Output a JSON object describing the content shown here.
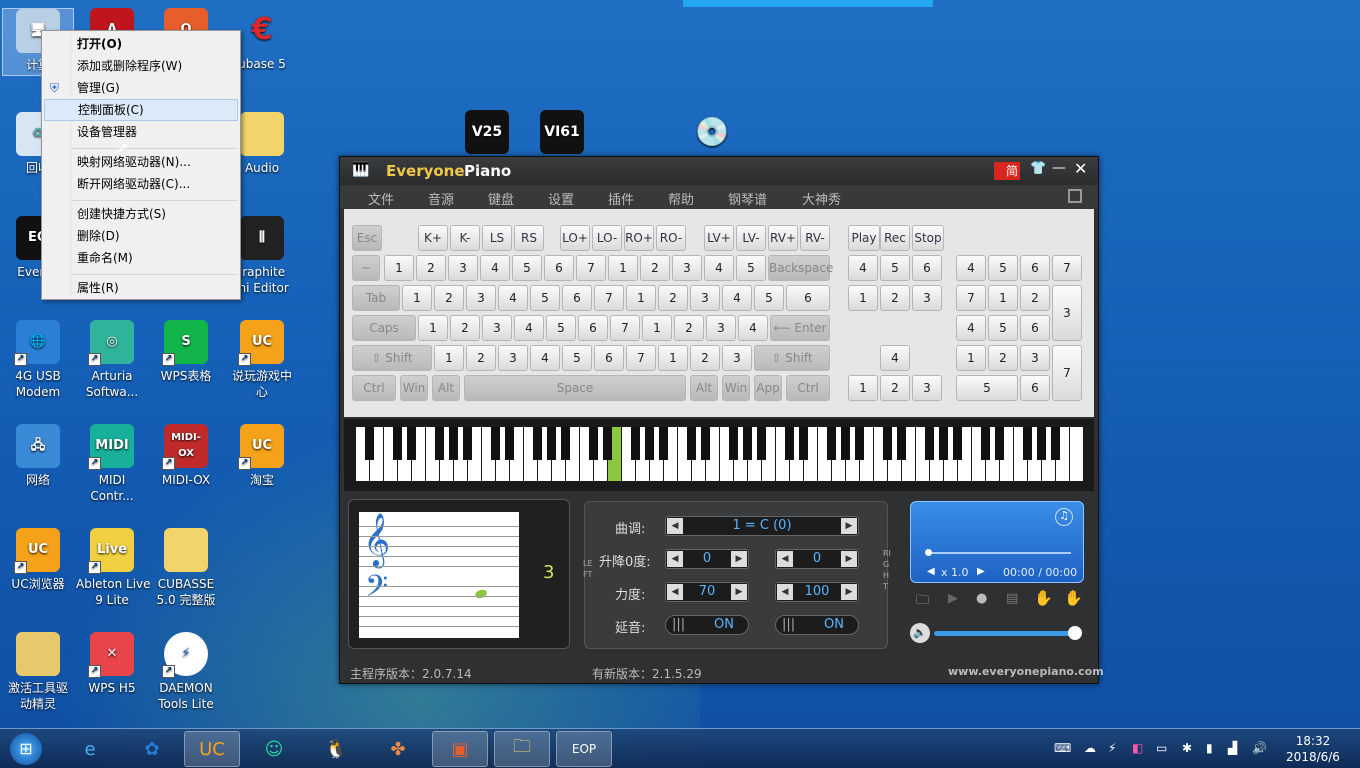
{
  "desktop_icons": [
    {
      "name": "computer",
      "label": "计算",
      "icon": "computer-icon"
    },
    {
      "name": "acrobat",
      "label": "",
      "icon": "acrobat-icon"
    },
    {
      "name": "office",
      "label": "",
      "icon": "office-icon"
    },
    {
      "name": "cubase5",
      "label": "ubase 5",
      "icon": "cubase-icon"
    },
    {
      "name": "recycle",
      "label": "回收",
      "icon": "recycle-bin-icon"
    },
    {
      "name": "audio",
      "label": "Audio",
      "icon": "folder-icon"
    },
    {
      "name": "everyone",
      "label": "Everyo",
      "icon": "everyone-piano-icon"
    },
    {
      "name": "graphite",
      "label": "iraphite\nini Editor",
      "icon": "mixer-icon"
    },
    {
      "name": "4gusb",
      "label": "4G USB\nModem",
      "icon": "globe-icon"
    },
    {
      "name": "arturia",
      "label": "Arturia\nSoftwa...",
      "icon": "arturia-icon"
    },
    {
      "name": "wps",
      "label": "WPS表格",
      "icon": "wps-sheet-icon"
    },
    {
      "name": "shuowan",
      "label": "说玩游戏中\n心",
      "icon": "uc-icon"
    },
    {
      "name": "network",
      "label": "网络",
      "icon": "network-icon"
    },
    {
      "name": "midi",
      "label": "MIDI\nContr...",
      "icon": "midi-icon"
    },
    {
      "name": "midiox",
      "label": "MIDI-OX",
      "icon": "midiox-icon"
    },
    {
      "name": "taobao",
      "label": "淘宝",
      "icon": "uc-icon"
    },
    {
      "name": "uc",
      "label": "UC浏览器",
      "icon": "uc-icon"
    },
    {
      "name": "ableton",
      "label": "Ableton Live\n9 Lite",
      "icon": "ableton-icon"
    },
    {
      "name": "cubasefolder",
      "label": "CUBASSE\n5.0 完整版",
      "icon": "folder-icon"
    },
    {
      "name": "jihuo",
      "label": "激活工具驱\n动精灵",
      "icon": "folder-red-icon"
    },
    {
      "name": "wpsh5",
      "label": "WPS H5",
      "icon": "wps-h5-icon"
    },
    {
      "name": "daemon",
      "label": "DAEMON\nTools Lite",
      "icon": "daemon-icon"
    },
    {
      "name": "v25",
      "label": "",
      "icon": "v25-icon"
    },
    {
      "name": "vi61",
      "label": "",
      "icon": "vi61-icon"
    },
    {
      "name": "installer",
      "label": "",
      "icon": "installer-icon"
    }
  ],
  "context_menu": [
    {
      "label": "打开(O)",
      "bold": true
    },
    {
      "label": "添加或删除程序(W)"
    },
    {
      "label": "管理(G)"
    },
    {
      "label": "控制面板(C)"
    },
    {
      "label": "设备管理器"
    },
    {
      "label": "映射网络驱动器(N)..."
    },
    {
      "label": "断开网络驱动器(C)..."
    },
    {
      "label": "创建快捷方式(S)"
    },
    {
      "label": "删除(D)"
    },
    {
      "label": "重命名(M)"
    },
    {
      "label": "属性(R)"
    }
  ],
  "app": {
    "title": "Everyone",
    "title2": "Piano",
    "lang": "简",
    "menus": [
      "文件",
      "音源",
      "键盘",
      "设置",
      "插件",
      "帮助",
      "钢琴谱",
      "大神秀"
    ],
    "row0": [
      "Esc",
      "K+",
      "K-",
      "LS",
      "RS",
      "LO+",
      "LO-",
      "RO+",
      "RO-",
      "LV+",
      "LV-",
      "RV+",
      "RV-",
      "Play",
      "Rec",
      "Stop"
    ],
    "backspace": "Backspace",
    "tab": "Tab",
    "caps": "Caps",
    "enter": "Enter",
    "shift": "Shift",
    "ctrl": "Ctrl",
    "win": "Win",
    "alt": "Alt",
    "space": "Space",
    "app": "App",
    "key_label": "曲调:",
    "key_value": "1 = C (0)",
    "trans_label": "升降0度:",
    "trans_left": "0",
    "trans_right": "0",
    "vel_label": "力度:",
    "vel_left": "70",
    "vel_right": "100",
    "sus_label": "延音:",
    "sus_left": "ON",
    "sus_right": "ON",
    "left": "LEFT",
    "right": "RIGHT",
    "note_num": "3",
    "speed": "x 1.0",
    "time": "00:00 / 00:00",
    "version": "主程序版本：2.0.7.14",
    "new_version": "有新版本：2.1.5.29",
    "site": "www.everyonepiano.com"
  },
  "tray": {
    "time": "18:32",
    "date": "2018/6/6"
  }
}
